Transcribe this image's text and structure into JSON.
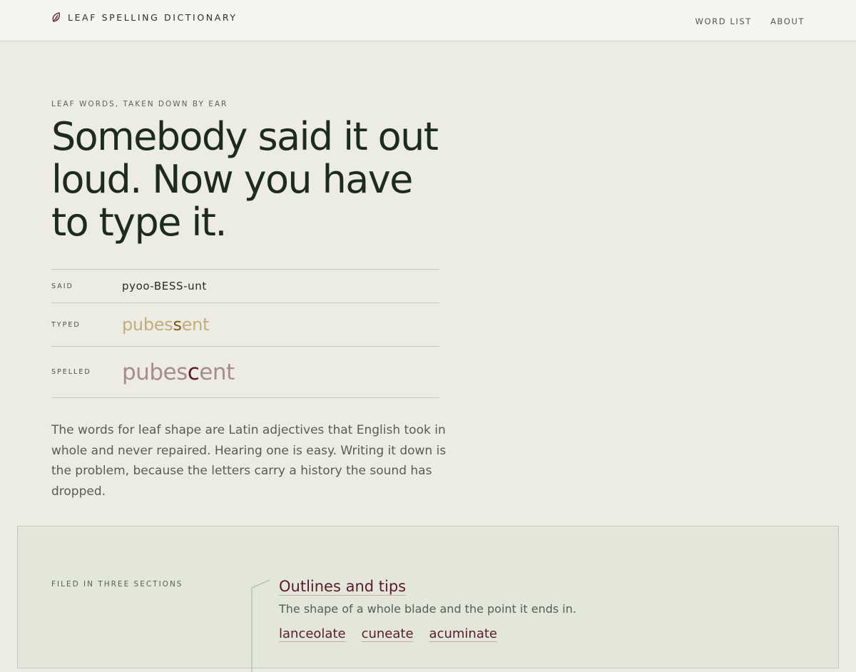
{
  "header": {
    "brand": "LEAF SPELLING DICTIONARY",
    "brand_icon": "leaf-icon",
    "nav": [
      "WORD LIST",
      "ABOUT"
    ]
  },
  "hero": {
    "eyebrow": "LEAF WORDS, TAKEN DOWN BY EAR",
    "headline": "Somebody said it out loud. Now you have to type it."
  },
  "example": {
    "said_label": "SAID",
    "said": "pyoo-BESS-unt",
    "typed_label": "TYPED",
    "typed_before": "pubes",
    "typed_highlight": "s",
    "typed_after": "ent",
    "spelled_label": "SPELLED",
    "spelled_before": "pubes",
    "spelled_highlight": "c",
    "spelled_after": "ent"
  },
  "intro": "The words for leaf shape are Latin adjectives that English took in whole and never repaired. Hearing one is easy. Writing it down is the problem, because the letters carry a history the sound has dropped.",
  "sections": {
    "label": "FILED IN THREE SECTIONS",
    "items": [
      {
        "title": "Outlines and tips",
        "description": "The shape of a whole blade and the point it ends in.",
        "words": [
          "lanceolate",
          "cuneate",
          "acuminate"
        ]
      }
    ]
  },
  "colors": {
    "background": "#ecece4",
    "header_bg": "#f5f5f0",
    "ink": "#1c2a20",
    "typed_accent": "#7e5a12",
    "spelled_accent": "#5a1a2a",
    "sections_bg": "#e3e7da"
  }
}
